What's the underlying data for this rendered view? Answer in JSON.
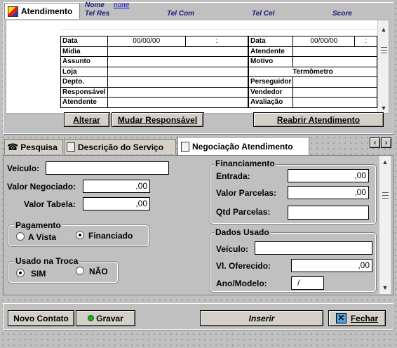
{
  "header": {
    "tab_title": "Atendimento",
    "nome_label": "Nome",
    "nome_value": "none",
    "tel_res": "Tel Res",
    "tel_com": "Tel Com",
    "tel_cel": "Tel Cel",
    "score": "Score"
  },
  "grid": {
    "left_rows": [
      "Data",
      "Mídia",
      "Assunto",
      "Loja",
      "Depto.",
      "Responsável",
      "Atendente"
    ],
    "left_date": "00/00/00",
    "left_time": ":",
    "right_rows": [
      "Data",
      "Atendente",
      "Motivo",
      "Termômetro",
      "Perseguidor",
      "Vendedor",
      "Avaliação"
    ],
    "right_date": "00/00/00",
    "right_time": ":"
  },
  "top_buttons": {
    "alterar": "Alterar",
    "mudar": "Mudar Responsável",
    "reabrir": "Reabrir Atendimento"
  },
  "tabs": [
    {
      "label": "Pesquisa",
      "icon": "telephone-icon"
    },
    {
      "label": "Descrição do Serviço",
      "icon": "book-icon"
    },
    {
      "label": "Negociação Atendimento",
      "icon": "document-icon"
    }
  ],
  "form": {
    "veiculo_label": "Veículo:",
    "veiculo_value": "",
    "valor_negociado_label": "Valor Negociado:",
    "valor_negociado_value": ",00",
    "valor_tabela_label": "Valor Tabela:",
    "valor_tabela_value": ",00",
    "pagamento": {
      "title": "Pagamento",
      "options": [
        "A Vista",
        "Financiado"
      ],
      "selected": "Financiado"
    },
    "usado": {
      "title": "Usado na Troca",
      "options": [
        "SIM",
        "NÃO"
      ],
      "selected": "SIM"
    },
    "financiamento": {
      "title": "Financiamento",
      "entrada_label": "Entrada:",
      "entrada_value": ",00",
      "parcelas_label": "Valor Parcelas:",
      "parcelas_value": ",00",
      "qtd_label": "Qtd Parcelas:",
      "qtd_value": ""
    },
    "dados_usado": {
      "title": "Dados Usado",
      "veiculo_label": "Veículo:",
      "veiculo_value": "",
      "oferecido_label": "Vl. Oferecido:",
      "oferecido_value": ",00",
      "ano_label": "Ano/Modelo:",
      "ano_value": "/"
    }
  },
  "bottom_buttons": {
    "novo_contato": "Novo Contato",
    "gravar": "Gravar",
    "inserir": "Inserir",
    "fechar": "Fechar"
  },
  "colors": {
    "panel": "#c0c0c0",
    "header_italic": "#1a1a7a",
    "link": "#0000cc",
    "gravar_dot": "#22aa22"
  }
}
